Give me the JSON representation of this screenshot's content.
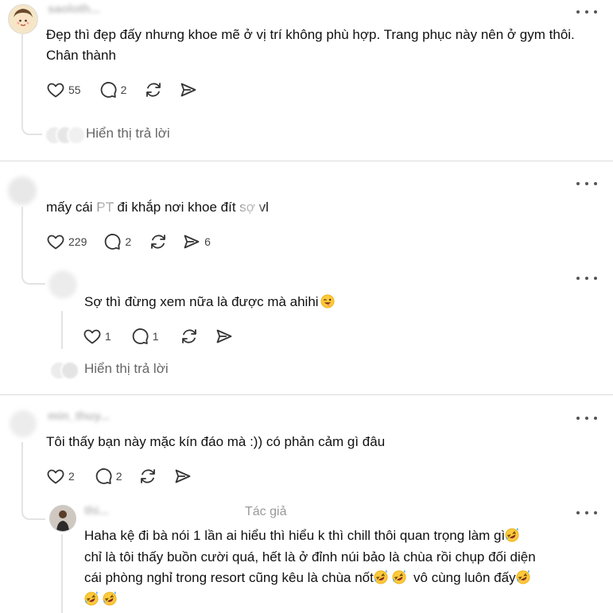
{
  "colors": {
    "text": "#111111",
    "muted": "#666666",
    "icon": "#444444",
    "divider": "#dcdcdc",
    "thread_line": "#e3e3e3"
  },
  "icons": {
    "like": "heart-icon",
    "reply": "comment-icon",
    "repost": "repost-icon",
    "share": "send-icon",
    "more": "more-icon",
    "emoji_wink": "winking-face-tongue-emoji",
    "emoji_laugh": "rofl-emoji"
  },
  "comments": [
    {
      "username": "saoloth...",
      "text": "Đẹp thì đẹp đấy nhưng khoe mẽ ở vị trí không phù hợp. Trang phục này nên ở gym thôi. Chân thành",
      "likes": "55",
      "replies": "2",
      "show_replies": "Hiển thị trả lời"
    },
    {
      "username": "",
      "text": "mấy cái PT đi khắp nơi khoe đít sợ vl",
      "likes": "229",
      "replies": "2",
      "shares": "6",
      "reply": {
        "username": "",
        "text": "Sợ thì đừng xem nữa là được mà ahihi",
        "likes": "1",
        "replies": "1"
      },
      "show_replies": "Hiển thị trả lời"
    },
    {
      "username": "min_thuy...",
      "text": "Tôi thấy bạn này mặc kín đáo mà :)) có phản cảm gì đâu",
      "likes": "2",
      "replies": "2",
      "reply": {
        "username": "thi...",
        "author_tag": "Tác giả",
        "line1": "Haha kệ đi bà nói 1 lần ai hiểu thì hiểu k thì chill thôi quan trọng làm gì",
        "line2": "chỉ là tôi thấy buồn cười quá, hết là ở đỉnh núi bảo là chùa rồi chụp đối diện",
        "line3": "cái phòng nghỉ trong resort cũng kêu là chùa nốt",
        "line3b": "vô cùng luôn đấy"
      }
    }
  ]
}
